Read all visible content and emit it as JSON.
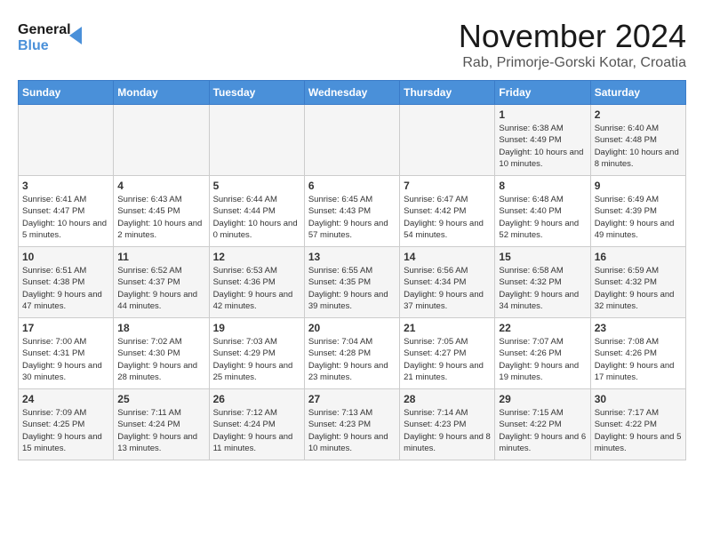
{
  "logo": {
    "line1": "General",
    "line2": "Blue"
  },
  "title": "November 2024",
  "subtitle": "Rab, Primorje-Gorski Kotar, Croatia",
  "days_of_week": [
    "Sunday",
    "Monday",
    "Tuesday",
    "Wednesday",
    "Thursday",
    "Friday",
    "Saturday"
  ],
  "weeks": [
    [
      {
        "day": "",
        "info": ""
      },
      {
        "day": "",
        "info": ""
      },
      {
        "day": "",
        "info": ""
      },
      {
        "day": "",
        "info": ""
      },
      {
        "day": "",
        "info": ""
      },
      {
        "day": "1",
        "info": "Sunrise: 6:38 AM\nSunset: 4:49 PM\nDaylight: 10 hours and 10 minutes."
      },
      {
        "day": "2",
        "info": "Sunrise: 6:40 AM\nSunset: 4:48 PM\nDaylight: 10 hours and 8 minutes."
      }
    ],
    [
      {
        "day": "3",
        "info": "Sunrise: 6:41 AM\nSunset: 4:47 PM\nDaylight: 10 hours and 5 minutes."
      },
      {
        "day": "4",
        "info": "Sunrise: 6:43 AM\nSunset: 4:45 PM\nDaylight: 10 hours and 2 minutes."
      },
      {
        "day": "5",
        "info": "Sunrise: 6:44 AM\nSunset: 4:44 PM\nDaylight: 10 hours and 0 minutes."
      },
      {
        "day": "6",
        "info": "Sunrise: 6:45 AM\nSunset: 4:43 PM\nDaylight: 9 hours and 57 minutes."
      },
      {
        "day": "7",
        "info": "Sunrise: 6:47 AM\nSunset: 4:42 PM\nDaylight: 9 hours and 54 minutes."
      },
      {
        "day": "8",
        "info": "Sunrise: 6:48 AM\nSunset: 4:40 PM\nDaylight: 9 hours and 52 minutes."
      },
      {
        "day": "9",
        "info": "Sunrise: 6:49 AM\nSunset: 4:39 PM\nDaylight: 9 hours and 49 minutes."
      }
    ],
    [
      {
        "day": "10",
        "info": "Sunrise: 6:51 AM\nSunset: 4:38 PM\nDaylight: 9 hours and 47 minutes."
      },
      {
        "day": "11",
        "info": "Sunrise: 6:52 AM\nSunset: 4:37 PM\nDaylight: 9 hours and 44 minutes."
      },
      {
        "day": "12",
        "info": "Sunrise: 6:53 AM\nSunset: 4:36 PM\nDaylight: 9 hours and 42 minutes."
      },
      {
        "day": "13",
        "info": "Sunrise: 6:55 AM\nSunset: 4:35 PM\nDaylight: 9 hours and 39 minutes."
      },
      {
        "day": "14",
        "info": "Sunrise: 6:56 AM\nSunset: 4:34 PM\nDaylight: 9 hours and 37 minutes."
      },
      {
        "day": "15",
        "info": "Sunrise: 6:58 AM\nSunset: 4:32 PM\nDaylight: 9 hours and 34 minutes."
      },
      {
        "day": "16",
        "info": "Sunrise: 6:59 AM\nSunset: 4:32 PM\nDaylight: 9 hours and 32 minutes."
      }
    ],
    [
      {
        "day": "17",
        "info": "Sunrise: 7:00 AM\nSunset: 4:31 PM\nDaylight: 9 hours and 30 minutes."
      },
      {
        "day": "18",
        "info": "Sunrise: 7:02 AM\nSunset: 4:30 PM\nDaylight: 9 hours and 28 minutes."
      },
      {
        "day": "19",
        "info": "Sunrise: 7:03 AM\nSunset: 4:29 PM\nDaylight: 9 hours and 25 minutes."
      },
      {
        "day": "20",
        "info": "Sunrise: 7:04 AM\nSunset: 4:28 PM\nDaylight: 9 hours and 23 minutes."
      },
      {
        "day": "21",
        "info": "Sunrise: 7:05 AM\nSunset: 4:27 PM\nDaylight: 9 hours and 21 minutes."
      },
      {
        "day": "22",
        "info": "Sunrise: 7:07 AM\nSunset: 4:26 PM\nDaylight: 9 hours and 19 minutes."
      },
      {
        "day": "23",
        "info": "Sunrise: 7:08 AM\nSunset: 4:26 PM\nDaylight: 9 hours and 17 minutes."
      }
    ],
    [
      {
        "day": "24",
        "info": "Sunrise: 7:09 AM\nSunset: 4:25 PM\nDaylight: 9 hours and 15 minutes."
      },
      {
        "day": "25",
        "info": "Sunrise: 7:11 AM\nSunset: 4:24 PM\nDaylight: 9 hours and 13 minutes."
      },
      {
        "day": "26",
        "info": "Sunrise: 7:12 AM\nSunset: 4:24 PM\nDaylight: 9 hours and 11 minutes."
      },
      {
        "day": "27",
        "info": "Sunrise: 7:13 AM\nSunset: 4:23 PM\nDaylight: 9 hours and 10 minutes."
      },
      {
        "day": "28",
        "info": "Sunrise: 7:14 AM\nSunset: 4:23 PM\nDaylight: 9 hours and 8 minutes."
      },
      {
        "day": "29",
        "info": "Sunrise: 7:15 AM\nSunset: 4:22 PM\nDaylight: 9 hours and 6 minutes."
      },
      {
        "day": "30",
        "info": "Sunrise: 7:17 AM\nSunset: 4:22 PM\nDaylight: 9 hours and 5 minutes."
      }
    ]
  ]
}
